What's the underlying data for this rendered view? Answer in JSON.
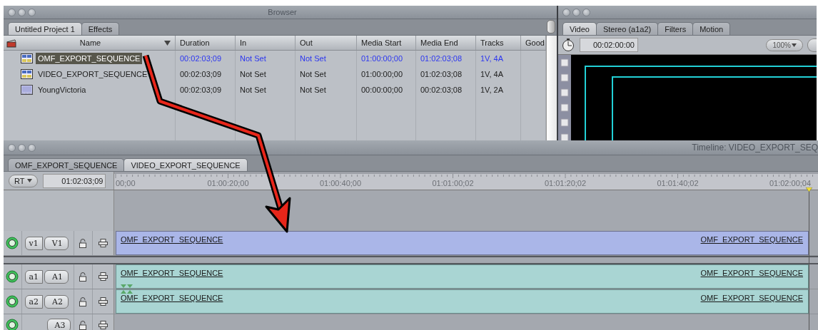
{
  "browser": {
    "title": "Browser",
    "tabs": [
      {
        "label": "Untitled Project 1",
        "selected": true
      },
      {
        "label": "Effects",
        "selected": false
      }
    ],
    "columns": [
      "Name",
      "Duration",
      "In",
      "Out",
      "Media Start",
      "Media End",
      "Tracks",
      "Good"
    ],
    "rows": [
      {
        "kind": "sequence",
        "selected": true,
        "cells": [
          "OMF_EXPORT_SEQUENCE",
          "00:02:03;09",
          "Not Set",
          "Not Set",
          "01:00:00;00",
          "01:02:03;08",
          "1V, 4A"
        ]
      },
      {
        "kind": "sequence",
        "selected": false,
        "cells": [
          "VIDEO_EXPORT_SEQUENCE",
          "00:02:03;09",
          "Not Set",
          "Not Set",
          "01:00:00;00",
          "01:02:03;08",
          "1V, 4A"
        ]
      },
      {
        "kind": "clip",
        "selected": false,
        "cells": [
          "YoungVictoria",
          "00:02:03;09",
          "Not Set",
          "Not Set",
          "00:00:00;00",
          "00:02:03;08",
          "1V, 2A"
        ]
      }
    ]
  },
  "viewer": {
    "tabs": [
      {
        "label": "Video",
        "selected": true
      },
      {
        "label": "Stereo (a1a2)",
        "selected": false
      },
      {
        "label": "Filters",
        "selected": false
      },
      {
        "label": "Motion",
        "selected": false
      }
    ],
    "timecode": "00:02:00:00",
    "zoom": "100%"
  },
  "timeline": {
    "title": "Timeline: VIDEO_EXPORT_SEQ",
    "tabs": [
      {
        "label": "OMF_EXPORT_SEQUENCE",
        "selected": false
      },
      {
        "label": "VIDEO_EXPORT_SEQUENCE",
        "selected": true
      }
    ],
    "rt": "RT",
    "timecode": "01:02:03;09",
    "ruler_labels": [
      "00;00",
      "01:00:20;00",
      "01:00:40;00",
      "01:01:00;02",
      "01:01:20;02",
      "01:01:40;02",
      "01:02:00;04"
    ],
    "tracks": [
      {
        "kind": "video",
        "source": "v1",
        "target": "V1",
        "visible": true,
        "clip": {
          "label_start": "OMF_EXPORT_SEQUENCE",
          "label_end": "OMF_EXPORT_SEQUENCE"
        }
      },
      {
        "kind": "audio",
        "source": "a1",
        "target": "A1",
        "visible": true,
        "clip": {
          "label_start": "OMF_EXPORT_SEQUENCE",
          "label_end": "OMF_EXPORT_SEQUENCE",
          "linked": true
        }
      },
      {
        "kind": "audio",
        "source": "a2",
        "target": "A2",
        "visible": true,
        "clip": {
          "label_start": "OMF_EXPORT_SEQUENCE",
          "label_end": "OMF_EXPORT_SEQUENCE",
          "linked": true
        }
      },
      {
        "kind": "audio",
        "target": "A3",
        "visible": true
      }
    ]
  }
}
